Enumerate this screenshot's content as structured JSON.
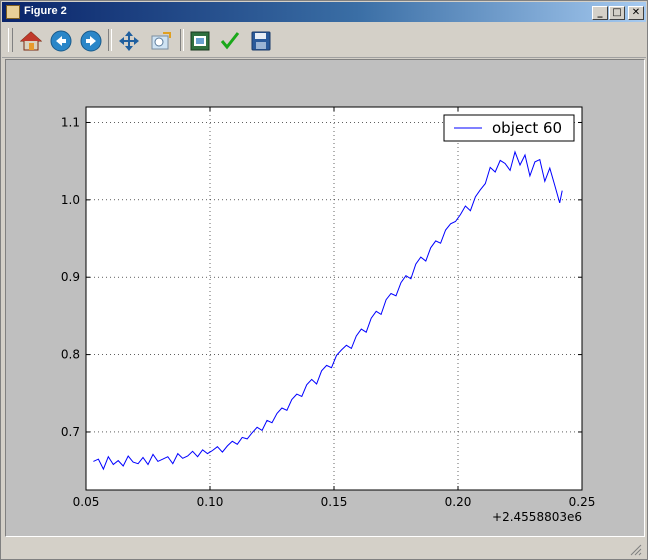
{
  "window": {
    "title": "Figure 2",
    "minimize": "_",
    "maximize": "□",
    "close": "✕"
  },
  "toolbar": {
    "buttons": [
      {
        "name": "home",
        "icon": "home-icon"
      },
      {
        "name": "back",
        "icon": "arrow-left-icon"
      },
      {
        "name": "forward",
        "icon": "arrow-right-icon"
      },
      {
        "name": "pan",
        "icon": "move-icon"
      },
      {
        "name": "zoom",
        "icon": "zoom-rect-icon"
      },
      {
        "name": "configure-subplots",
        "icon": "subplots-icon"
      },
      {
        "name": "edit-axis",
        "icon": "checkmark-icon"
      },
      {
        "name": "save",
        "icon": "floppy-disk-icon"
      }
    ]
  },
  "chart_data": {
    "type": "line",
    "x_offset_label": "+2.4558803e6",
    "xlim": [
      0.05,
      0.25
    ],
    "ylim": [
      0.625,
      1.12
    ],
    "x_ticks": [
      0.05,
      0.1,
      0.15,
      0.2,
      0.25
    ],
    "x_tick_labels": [
      "0.05",
      "0.10",
      "0.15",
      "0.20",
      "0.25"
    ],
    "y_ticks": [
      0.7,
      0.8,
      0.9,
      1.0,
      1.1
    ],
    "y_tick_labels": [
      "0.7",
      "0.8",
      "0.9",
      "1.0",
      "1.1"
    ],
    "grid": true,
    "legend_position": "top-right",
    "series": [
      {
        "name": "object 60",
        "color": "#0000ff",
        "x": [
          0.053,
          0.055,
          0.057,
          0.059,
          0.061,
          0.063,
          0.065,
          0.067,
          0.069,
          0.071,
          0.073,
          0.075,
          0.077,
          0.079,
          0.081,
          0.083,
          0.085,
          0.087,
          0.089,
          0.091,
          0.093,
          0.095,
          0.097,
          0.099,
          0.101,
          0.103,
          0.105,
          0.107,
          0.109,
          0.111,
          0.113,
          0.115,
          0.117,
          0.119,
          0.121,
          0.123,
          0.125,
          0.127,
          0.129,
          0.131,
          0.133,
          0.135,
          0.137,
          0.139,
          0.141,
          0.143,
          0.145,
          0.147,
          0.149,
          0.151,
          0.153,
          0.155,
          0.157,
          0.159,
          0.161,
          0.163,
          0.165,
          0.167,
          0.169,
          0.171,
          0.173,
          0.175,
          0.177,
          0.179,
          0.181,
          0.183,
          0.185,
          0.187,
          0.189,
          0.191,
          0.193,
          0.195,
          0.197,
          0.199,
          0.201,
          0.203,
          0.205,
          0.207,
          0.209,
          0.211,
          0.213,
          0.215,
          0.217,
          0.219,
          0.221,
          0.223,
          0.225,
          0.227,
          0.229,
          0.231,
          0.233,
          0.235,
          0.237,
          0.239,
          0.241,
          0.242
        ],
        "y": [
          0.662,
          0.665,
          0.652,
          0.668,
          0.658,
          0.663,
          0.656,
          0.669,
          0.661,
          0.659,
          0.667,
          0.658,
          0.671,
          0.662,
          0.665,
          0.668,
          0.659,
          0.672,
          0.666,
          0.669,
          0.675,
          0.668,
          0.677,
          0.672,
          0.676,
          0.681,
          0.674,
          0.682,
          0.688,
          0.684,
          0.693,
          0.691,
          0.699,
          0.706,
          0.702,
          0.715,
          0.712,
          0.724,
          0.731,
          0.728,
          0.742,
          0.749,
          0.746,
          0.761,
          0.768,
          0.762,
          0.779,
          0.786,
          0.783,
          0.799,
          0.806,
          0.812,
          0.808,
          0.824,
          0.833,
          0.829,
          0.847,
          0.856,
          0.852,
          0.871,
          0.879,
          0.876,
          0.893,
          0.902,
          0.898,
          0.917,
          0.926,
          0.921,
          0.938,
          0.947,
          0.944,
          0.961,
          0.969,
          0.972,
          0.981,
          0.992,
          0.986,
          1.004,
          1.013,
          1.021,
          1.042,
          1.036,
          1.051,
          1.047,
          1.038,
          1.062,
          1.045,
          1.058,
          1.031,
          1.049,
          1.052,
          1.024,
          1.041,
          1.019,
          0.996,
          1.012
        ]
      }
    ]
  }
}
